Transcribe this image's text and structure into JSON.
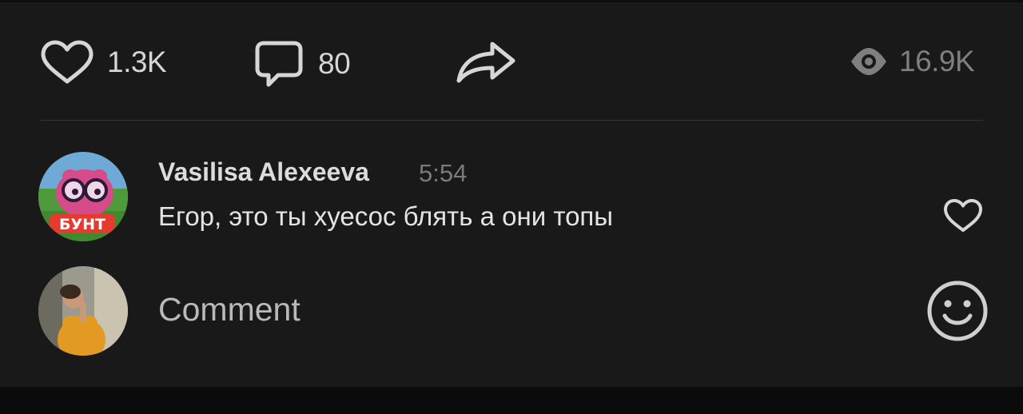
{
  "post_actions": {
    "likes_count": "1.3K",
    "comments_count": "80",
    "views_count": "16.9K"
  },
  "icons": {
    "like": "heart-outline-icon",
    "comment": "speech-bubble-icon",
    "share": "share-arrow-icon",
    "views": "eye-icon",
    "comment_like": "heart-outline-icon",
    "emoji": "smiley-face-icon"
  },
  "comment": {
    "author": "Vasilisa Alexeeva",
    "time": "5:54",
    "text": "Егор, это ты хуесос блять а они топы",
    "avatar_badge": "БУНТ"
  },
  "comment_input": {
    "placeholder": "Comment"
  },
  "colors": {
    "background": "#191919",
    "text_primary": "#e4e4e4",
    "text_muted": "#7a7a7a",
    "icon": "#d6d6d6"
  }
}
